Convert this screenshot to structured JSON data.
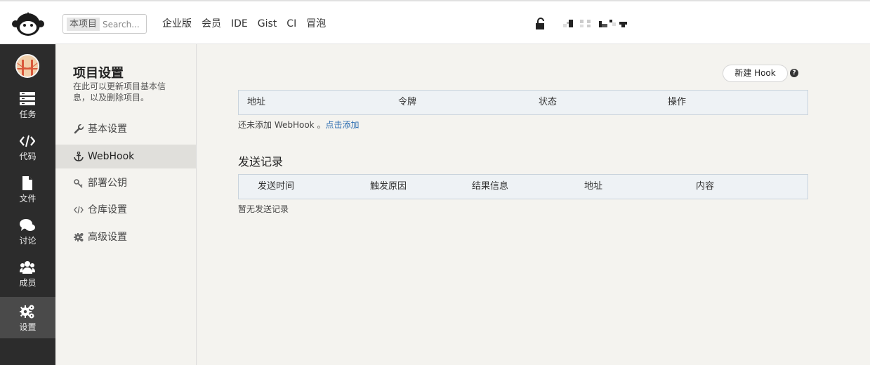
{
  "header": {
    "search": {
      "scope": "本项目",
      "placeholder": "Search..."
    },
    "nav": [
      "企业版",
      "会员",
      "IDE",
      "Gist",
      "CI",
      "冒泡"
    ]
  },
  "sidebar": {
    "items": [
      {
        "label": "任务",
        "icon": "tasks-icon"
      },
      {
        "label": "代码",
        "icon": "code-icon"
      },
      {
        "label": "文件",
        "icon": "file-icon"
      },
      {
        "label": "讨论",
        "icon": "chat-icon"
      },
      {
        "label": "成员",
        "icon": "members-icon"
      },
      {
        "label": "设置",
        "icon": "settings-icon",
        "active": true
      }
    ]
  },
  "settings_nav": {
    "title": "项目设置",
    "description": "在此可以更新项目基本信息，以及删除项目。",
    "items": [
      {
        "label": "基本设置",
        "icon": "wrench-icon"
      },
      {
        "label": "WebHook",
        "icon": "anchor-icon",
        "active": true
      },
      {
        "label": "部署公钥",
        "icon": "key-icon"
      },
      {
        "label": "仓库设置",
        "icon": "code-icon"
      },
      {
        "label": "高级设置",
        "icon": "gear-icon"
      }
    ]
  },
  "webhook": {
    "new_button": "新建 Hook",
    "columns": [
      "地址",
      "令牌",
      "状态",
      "操作"
    ],
    "empty_text": "还未添加 WebHook 。",
    "empty_link": "点击添加"
  },
  "records": {
    "title": "发送记录",
    "columns": [
      "发送时间",
      "触发原因",
      "结果信息",
      "地址",
      "内容"
    ],
    "empty_text": "暂无发送记录"
  }
}
